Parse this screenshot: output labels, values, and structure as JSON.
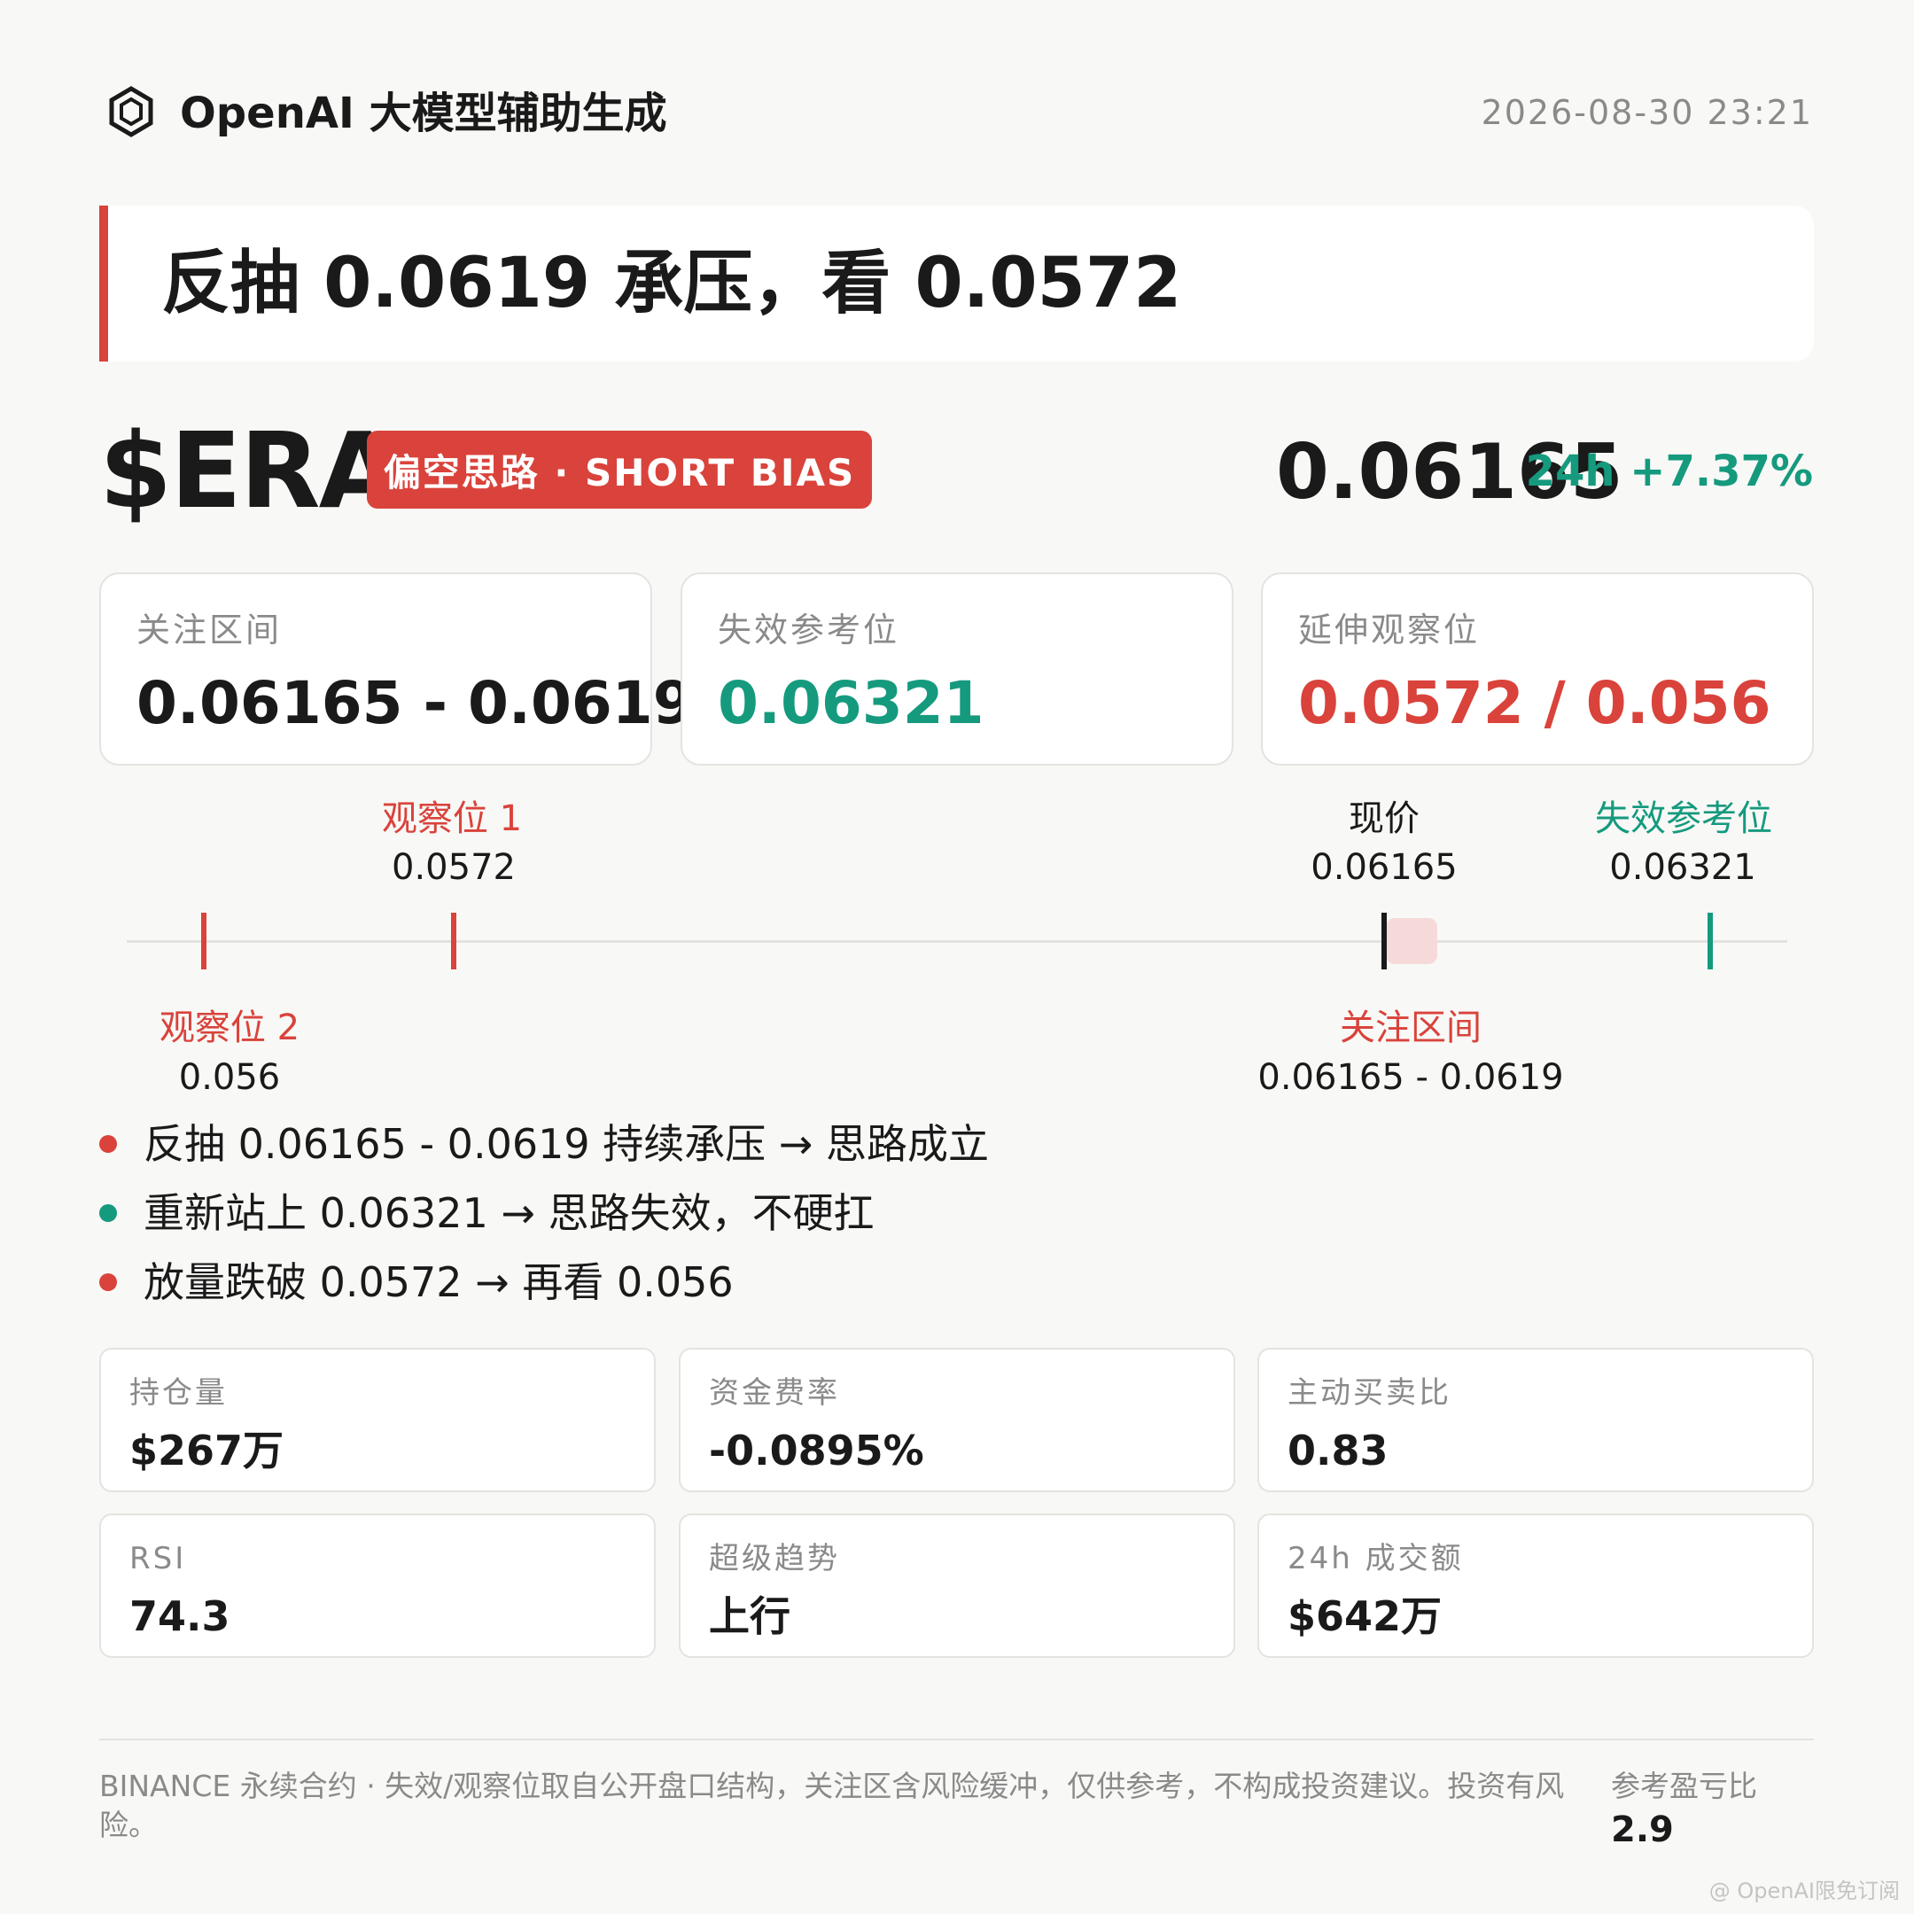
{
  "header": {
    "brand_icon": "openai-hexagon-icon",
    "brand_name": "OpenAI 大模型辅助生成",
    "timestamp": "2026-08-30 23:21"
  },
  "headline": "反抽 0.0619 承压，看 0.0572",
  "ticker": {
    "symbol": "$ERA",
    "bias_label": "偏空思路 · SHORT BIAS",
    "price": "0.06165",
    "change": "24h +7.37%"
  },
  "levels": [
    {
      "label": "关注区间",
      "value": "0.06165 - 0.0619",
      "color": "#1a1a1a"
    },
    {
      "label": "失效参考位",
      "value": "0.06321",
      "color": "#159a7e"
    },
    {
      "label": "延伸观察位",
      "value": "0.0572 / 0.056",
      "color": "#d9433b"
    }
  ],
  "scale": {
    "watch1": {
      "label": "观察位 1",
      "value": "0.0572"
    },
    "watch2": {
      "label": "观察位 2",
      "value": "0.056"
    },
    "current": {
      "label": "现价",
      "value": "0.06165"
    },
    "invalid": {
      "label": "失效参考位",
      "value": "0.06321"
    },
    "zone": {
      "label": "关注区间",
      "value": "0.06165 - 0.0619"
    }
  },
  "bullets": [
    {
      "text": "反抽 0.06165 - 0.0619 持续承压 → 思路成立",
      "color": "#d9433b"
    },
    {
      "text": "重新站上 0.06321 → 思路失效，不硬扛",
      "color": "#159a7e"
    },
    {
      "text": "放量跌破 0.0572 → 再看 0.056",
      "color": "#d9433b"
    }
  ],
  "metrics": [
    {
      "label": "持仓量",
      "value": "$267万"
    },
    {
      "label": "资金费率",
      "value": "-0.0895%"
    },
    {
      "label": "主动买卖比",
      "value": "0.83"
    },
    {
      "label": "RSI",
      "value": "74.3"
    },
    {
      "label": "超级趋势",
      "value": "上行"
    },
    {
      "label": "24h 成交额",
      "value": "$642万"
    }
  ],
  "footer": {
    "note": "BINANCE 永续合约 · 失效/观察位取自公开盘口结构，关注区含风险缓冲，仅供参考，不构成投资建议。投资有风险。",
    "rr_label": "参考盈亏比",
    "rr_value": "2.9"
  },
  "watermark": "@ OpenAI限免订阅",
  "colors": {
    "accent_red": "#d9433b",
    "accent_green": "#159a7e",
    "muted": "#8a8a8a"
  }
}
